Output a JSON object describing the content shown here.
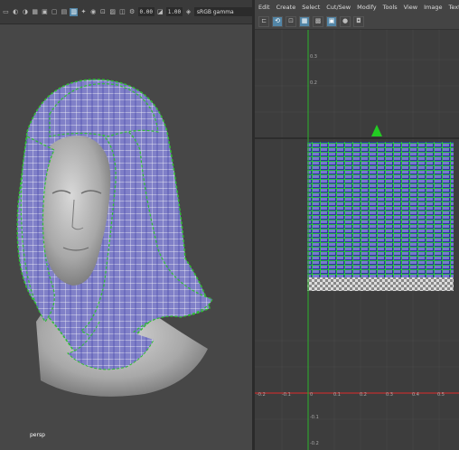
{
  "viewport": {
    "toolbar": {
      "icons": [
        "select-icon",
        "lasso-icon",
        "paint-icon",
        "grid-icon",
        "wireframe-icon",
        "shaded-icon",
        "textured-icon",
        "light-icon",
        "shadow-icon",
        "ao-icon",
        "isolate-icon",
        "xray-icon",
        "camera-icon",
        "gear-icon"
      ],
      "exposure_value": "0.00",
      "gamma_value": "1.00",
      "color_space": "sRGB gamma"
    },
    "camera_label": "persp"
  },
  "uv_editor": {
    "menu": [
      "Edit",
      "Create",
      "Select",
      "Cut/Sew",
      "Modify",
      "Tools",
      "View",
      "Image",
      "Textures"
    ],
    "tools": [
      "move-icon",
      "rotate-icon",
      "scale-icon",
      "grid-toggle-icon",
      "checker-icon",
      "shaded-uv-icon",
      "dim-icon",
      "snapshot-icon"
    ],
    "tick_labels_x": [
      "-0.2",
      "-0.1",
      "0",
      "0.1",
      "0.2",
      "0.3",
      "0.4",
      "0.5"
    ],
    "tick_labels_y": [
      "0.3",
      "0.2",
      "-0.1",
      "-0.2"
    ],
    "colors": {
      "uv_shell": "#1ec81e",
      "uv_fill": "#6e6ec8",
      "x_axis": "#c03030",
      "y_axis": "#30a030",
      "background": "#3d3d3d"
    }
  }
}
